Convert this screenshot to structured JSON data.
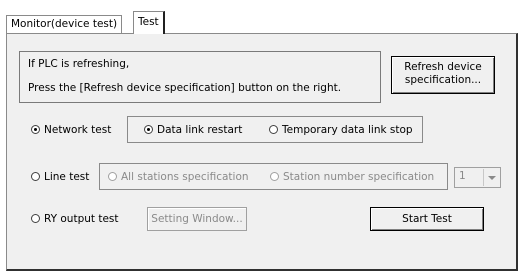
{
  "tabs": [
    {
      "label": "Monitor(device test)",
      "active": false
    },
    {
      "label": "Test",
      "active": true
    }
  ],
  "info": {
    "line1": "If PLC is refreshing,",
    "line2": "Press the [Refresh device specification] button on the right."
  },
  "refresh_button": {
    "line1": "Refresh device",
    "line2": "specification..."
  },
  "network_test": {
    "label": "Network test",
    "selected": true,
    "options": [
      {
        "label": "Data link restart",
        "selected": true
      },
      {
        "label": "Temporary data link stop",
        "selected": false
      }
    ]
  },
  "line_test": {
    "label": "Line test",
    "selected": false,
    "options": [
      {
        "label": "All stations specification",
        "selected": false
      },
      {
        "label": "Station number specification",
        "selected": false
      }
    ],
    "station_value": "1"
  },
  "ry_output_test": {
    "label": "RY output test",
    "selected": false,
    "setting_button": "Setting Window..."
  },
  "start_button": "Start Test"
}
